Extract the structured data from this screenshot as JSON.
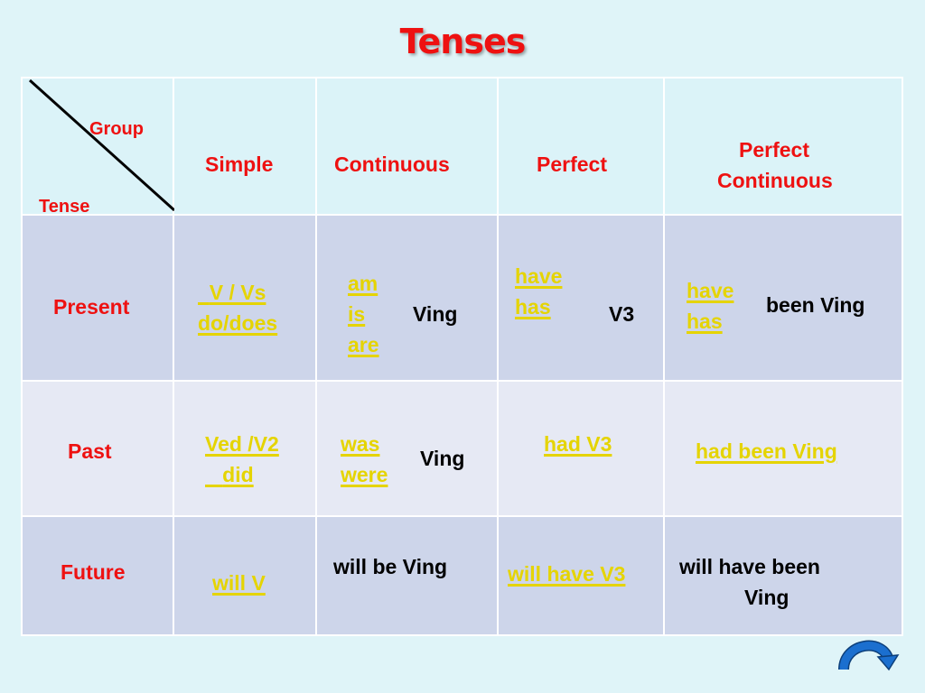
{
  "title": "Tenses",
  "corner": {
    "group_label": "Group",
    "tense_label": "Tense"
  },
  "columns": {
    "simple": "Simple",
    "continuous": "Continuous",
    "perfect": "Perfect",
    "perfect_continuous_1": "Perfect",
    "perfect_continuous_2": "Continuous"
  },
  "rows": {
    "present": {
      "label": "Present",
      "simple_1": "V / Vs",
      "simple_2": "do/does",
      "cont_aux_1": "am",
      "cont_aux_2": "is",
      "cont_aux_3": "are",
      "cont_main": "Ving",
      "perf_aux_1": "have",
      "perf_aux_2": "has",
      "perf_main": "V3",
      "pc_aux_1": "have",
      "pc_aux_2": "has",
      "pc_main": "been Ving"
    },
    "past": {
      "label": "Past",
      "simple_1": "Ved /V2",
      "simple_2": "did",
      "cont_aux_1": "was",
      "cont_aux_2": "were",
      "cont_main": "Ving",
      "perf": "had V3",
      "pc": "had been Ving"
    },
    "future": {
      "label": "Future",
      "simple": "will V",
      "cont": "will be Ving",
      "perf": "will have V3",
      "pc_1": "will have been",
      "pc_2": "Ving"
    }
  },
  "nav": {
    "next_icon": "curved-arrow-right-icon"
  }
}
